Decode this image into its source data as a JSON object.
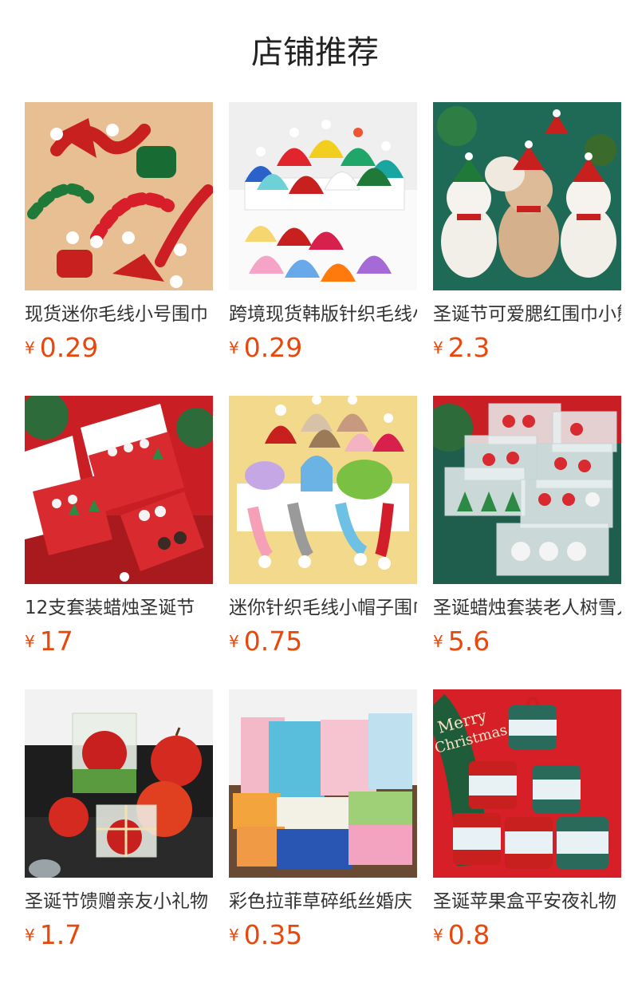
{
  "section": {
    "title": "店铺推荐"
  },
  "products": [
    {
      "name": "现货迷你毛线小号围巾",
      "currency": "¥",
      "price": "0.29",
      "image_icon": "knit-scarves-image"
    },
    {
      "name": "跨境现货韩版针织毛线小帽子",
      "currency": "¥",
      "price": "0.29",
      "image_icon": "knit-hats-image"
    },
    {
      "name": "圣诞节可爱腮红围巾小熊",
      "currency": "¥",
      "price": "2.3",
      "image_icon": "teddy-bears-image"
    },
    {
      "name": "12支套装蜡烛圣诞节",
      "currency": "¥",
      "price": "17",
      "image_icon": "candle-boxes-image"
    },
    {
      "name": "迷你针织毛线小帽子围巾",
      "currency": "¥",
      "price": "0.75",
      "image_icon": "mini-knits-image"
    },
    {
      "name": "圣诞蜡烛套装老人树雪人",
      "currency": "¥",
      "price": "5.6",
      "image_icon": "candle-sets-image"
    },
    {
      "name": "圣诞节馈赠亲友小礼物",
      "currency": "¥",
      "price": "1.7",
      "image_icon": "apple-candles-image"
    },
    {
      "name": "彩色拉菲草碎纸丝婚庆",
      "currency": "¥",
      "price": "0.35",
      "image_icon": "paper-shred-image"
    },
    {
      "name": "圣诞苹果盒平安夜礼物",
      "currency": "¥",
      "price": "0.8",
      "image_icon": "apple-gift-boxes-image"
    }
  ],
  "colors": {
    "price": "#e8480c",
    "title": "#222222",
    "text": "#333333"
  }
}
